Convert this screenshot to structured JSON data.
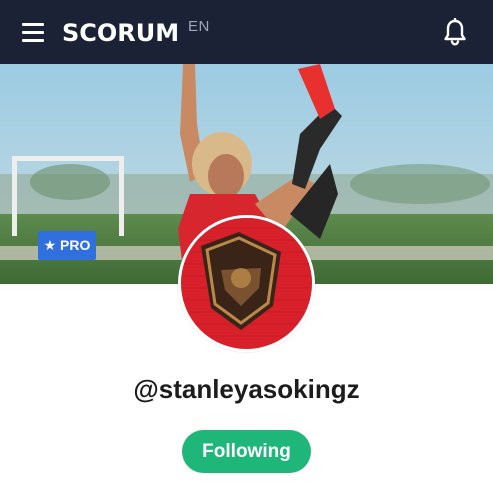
{
  "header": {
    "logo_text": "SCORUM",
    "language": "EN",
    "menu_icon": "hamburger-menu-icon",
    "notification_icon": "bell-icon",
    "background_color": "#1b2235"
  },
  "profile": {
    "badge_label": "★ PRO",
    "badge_color": "#2f6fde",
    "username": "@stanleyasokingz",
    "follow_label": "Following",
    "follow_color": "#1fb67a"
  }
}
